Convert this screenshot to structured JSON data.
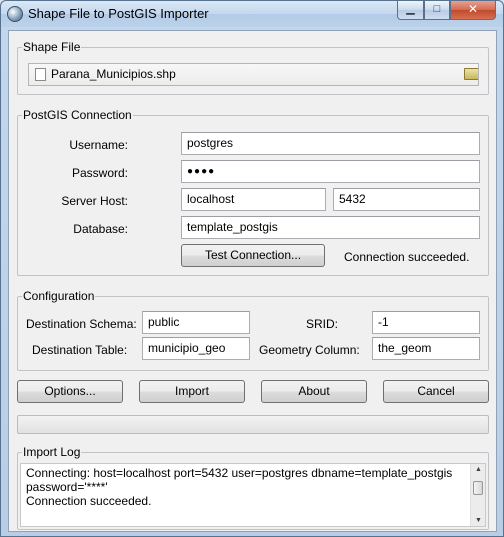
{
  "window": {
    "title": "Shape File to PostGIS Importer"
  },
  "shape_file": {
    "group_label": "Shape File",
    "path": "Parana_Municipios.shp"
  },
  "connection": {
    "group_label": "PostGIS Connection",
    "username_label": "Username:",
    "username": "postgres",
    "password_label": "Password:",
    "password_mask": "●●●●",
    "server_host_label": "Server Host:",
    "host": "localhost",
    "port": "5432",
    "database_label": "Database:",
    "database": "template_postgis",
    "test_button": "Test Connection...",
    "status": "Connection succeeded."
  },
  "configuration": {
    "group_label": "Configuration",
    "schema_label": "Destination Schema:",
    "schema": "public",
    "srid_label": "SRID:",
    "srid": "-1",
    "table_label": "Destination Table:",
    "table": "municipio_geo",
    "geometry_label": "Geometry Column:",
    "geometry": "the_geom"
  },
  "buttons": {
    "options": "Options...",
    "import": "Import",
    "about": "About",
    "cancel": "Cancel"
  },
  "progress": {
    "value": 0
  },
  "log": {
    "group_label": "Import Log",
    "lines": [
      "Connecting:  host=localhost port=5432 user=postgres dbname=template_postgis",
      "password='****'",
      "Connection succeeded."
    ]
  },
  "icons": {
    "app": "globe-icon",
    "file": "file-icon",
    "folder": "folder-icon"
  }
}
